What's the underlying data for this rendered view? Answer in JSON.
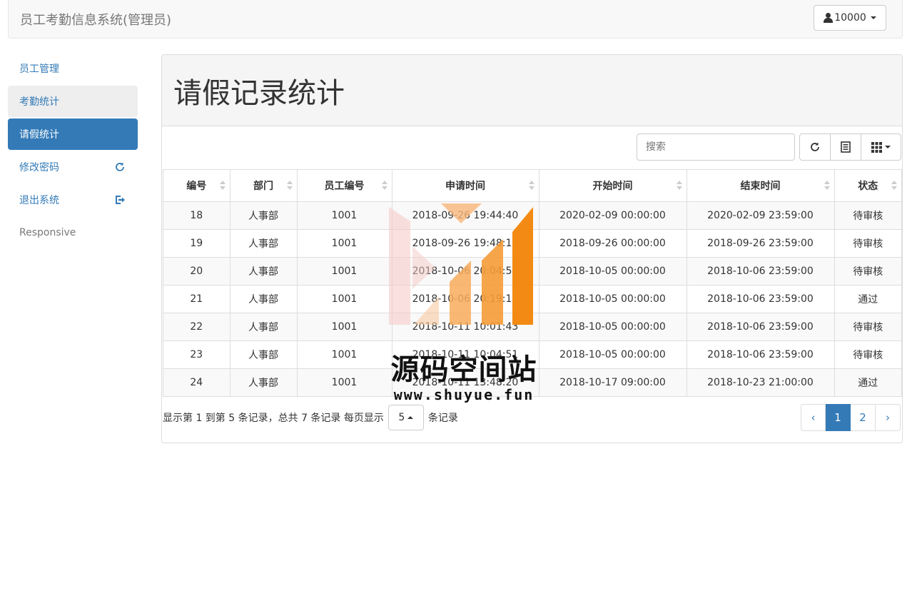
{
  "header": {
    "brand": "员工考勤信息系统(管理员)",
    "user_label": "10000",
    "user_icon": "user-icon"
  },
  "sidebar": {
    "items": [
      {
        "label": "员工管理",
        "state": "normal"
      },
      {
        "label": "考勤统计",
        "state": "hover"
      },
      {
        "label": "请假统计",
        "state": "active"
      },
      {
        "label": "修改密码",
        "state": "normal",
        "icon": "refresh-icon"
      },
      {
        "label": "退出系统",
        "state": "normal",
        "icon": "logout-icon"
      },
      {
        "label": "Responsive",
        "state": "plain"
      }
    ]
  },
  "main": {
    "title": "请假记录统计",
    "search_placeholder": "搜索",
    "toolbar_icons": [
      "refresh-icon",
      "toggle-view-icon",
      "columns-icon"
    ]
  },
  "table": {
    "columns": [
      "编号",
      "部门",
      "员工编号",
      "申请时间",
      "开始时间",
      "结束时间",
      "状态"
    ],
    "rows": [
      [
        "18",
        "人事部",
        "1001",
        "2018-09-26 19:44:40",
        "2020-02-09 00:00:00",
        "2020-02-09 23:59:00",
        "待审核"
      ],
      [
        "19",
        "人事部",
        "1001",
        "2018-09-26 19:48:18",
        "2018-09-26 00:00:00",
        "2018-09-26 23:59:00",
        "待审核"
      ],
      [
        "20",
        "人事部",
        "1001",
        "2018-10-06 20:04:57",
        "2018-10-05 00:00:00",
        "2018-10-06 23:59:00",
        "待审核"
      ],
      [
        "21",
        "人事部",
        "1001",
        "2018-10-06 20:19:17",
        "2018-10-05 00:00:00",
        "2018-10-06 23:59:00",
        "通过"
      ],
      [
        "22",
        "人事部",
        "1001",
        "2018-10-11 10:01:43",
        "2018-10-05 00:00:00",
        "2018-10-06 23:59:00",
        "待审核"
      ],
      [
        "23",
        "人事部",
        "1001",
        "2018-10-11 10:04:51",
        "2018-10-05 00:00:00",
        "2018-10-06 23:59:00",
        "待审核"
      ],
      [
        "24",
        "人事部",
        "1001",
        "2018-10-11 13:48:20",
        "2018-10-17 09:00:00",
        "2018-10-23 21:00:00",
        "通过"
      ]
    ]
  },
  "footer": {
    "info_before": "显示第 1 到第 5 条记录，总共 7 条记录 每页显示",
    "page_size": "5",
    "info_after": "条记录",
    "pages": [
      "‹",
      "1",
      "2",
      "›"
    ],
    "active_page": "1"
  },
  "watermark": {
    "text": "源码空间站",
    "url": "www.shuyue.fun"
  },
  "colors": {
    "primary": "#337ab7",
    "watermark_orange": "#f38a13"
  }
}
